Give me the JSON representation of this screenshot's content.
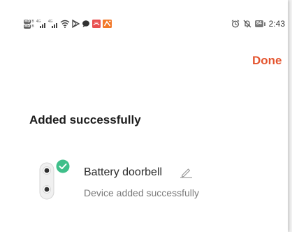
{
  "status_bar": {
    "hd_badge": "HD",
    "hd_sub": "B",
    "signal_1_label": "4G",
    "signal_2_label": "4G",
    "battery_level": "84",
    "time": "2:43",
    "notification_icons": [
      "wifi-icon",
      "play-store-icon",
      "chat-bubble-icon",
      "app-icon-red",
      "app-icon-orange"
    ],
    "status_icons": [
      "alarm-icon",
      "mute-icon",
      "battery-icon"
    ],
    "app_icon_colors": [
      "#e94f4f",
      "#f2792a"
    ]
  },
  "header": {
    "done_label": "Done",
    "accent_color": "#e4552f"
  },
  "title": "Added successfully",
  "device": {
    "name": "Battery doorbell",
    "status": "Device added successfully",
    "icon": "doorbell-icon",
    "badge_icon": "check-badge-icon",
    "badge_color": "#3fbf8a"
  }
}
